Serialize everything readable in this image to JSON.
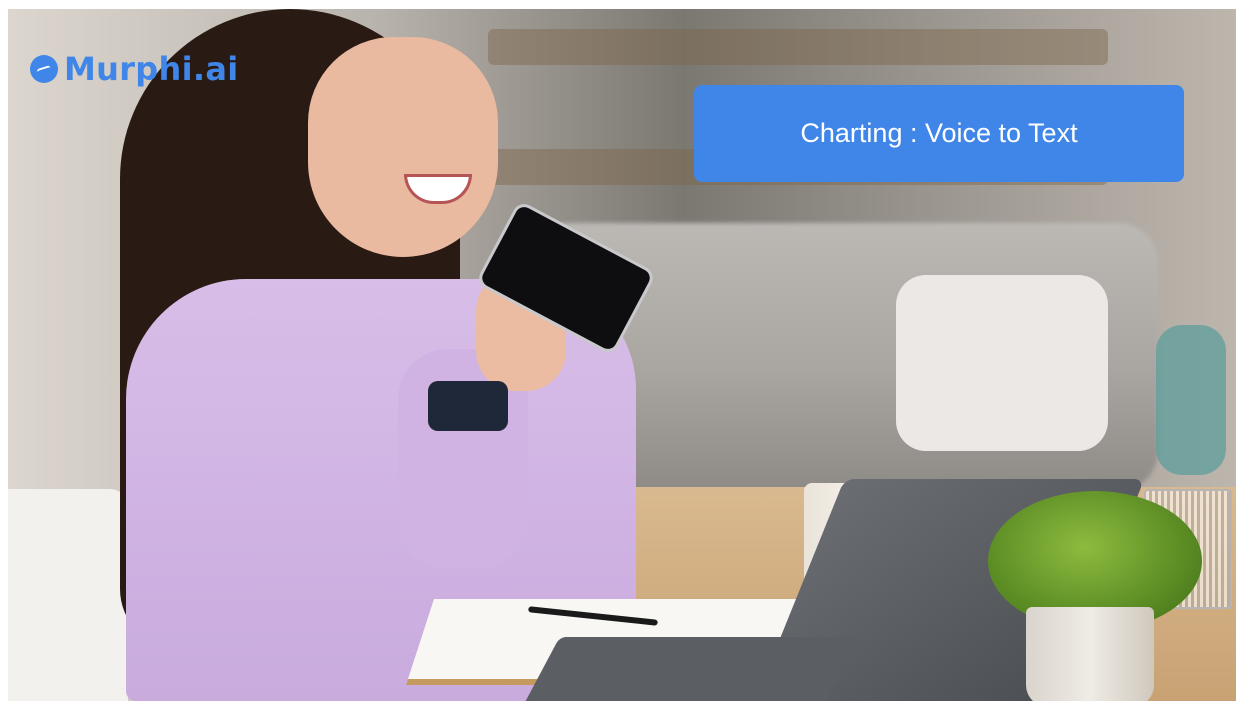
{
  "logo": {
    "text": "Murphi.ai",
    "icon": "murphi-logo-icon"
  },
  "banner": {
    "text": "Charting : Voice to Text"
  },
  "colors": {
    "brand_blue": "#3f86e8",
    "banner_text": "#ffffff"
  },
  "scene": {
    "subjects": [
      "woman-speaking-into-phone",
      "laptop",
      "notebook",
      "coffee-mug",
      "potted-plant",
      "pen-cup"
    ]
  }
}
